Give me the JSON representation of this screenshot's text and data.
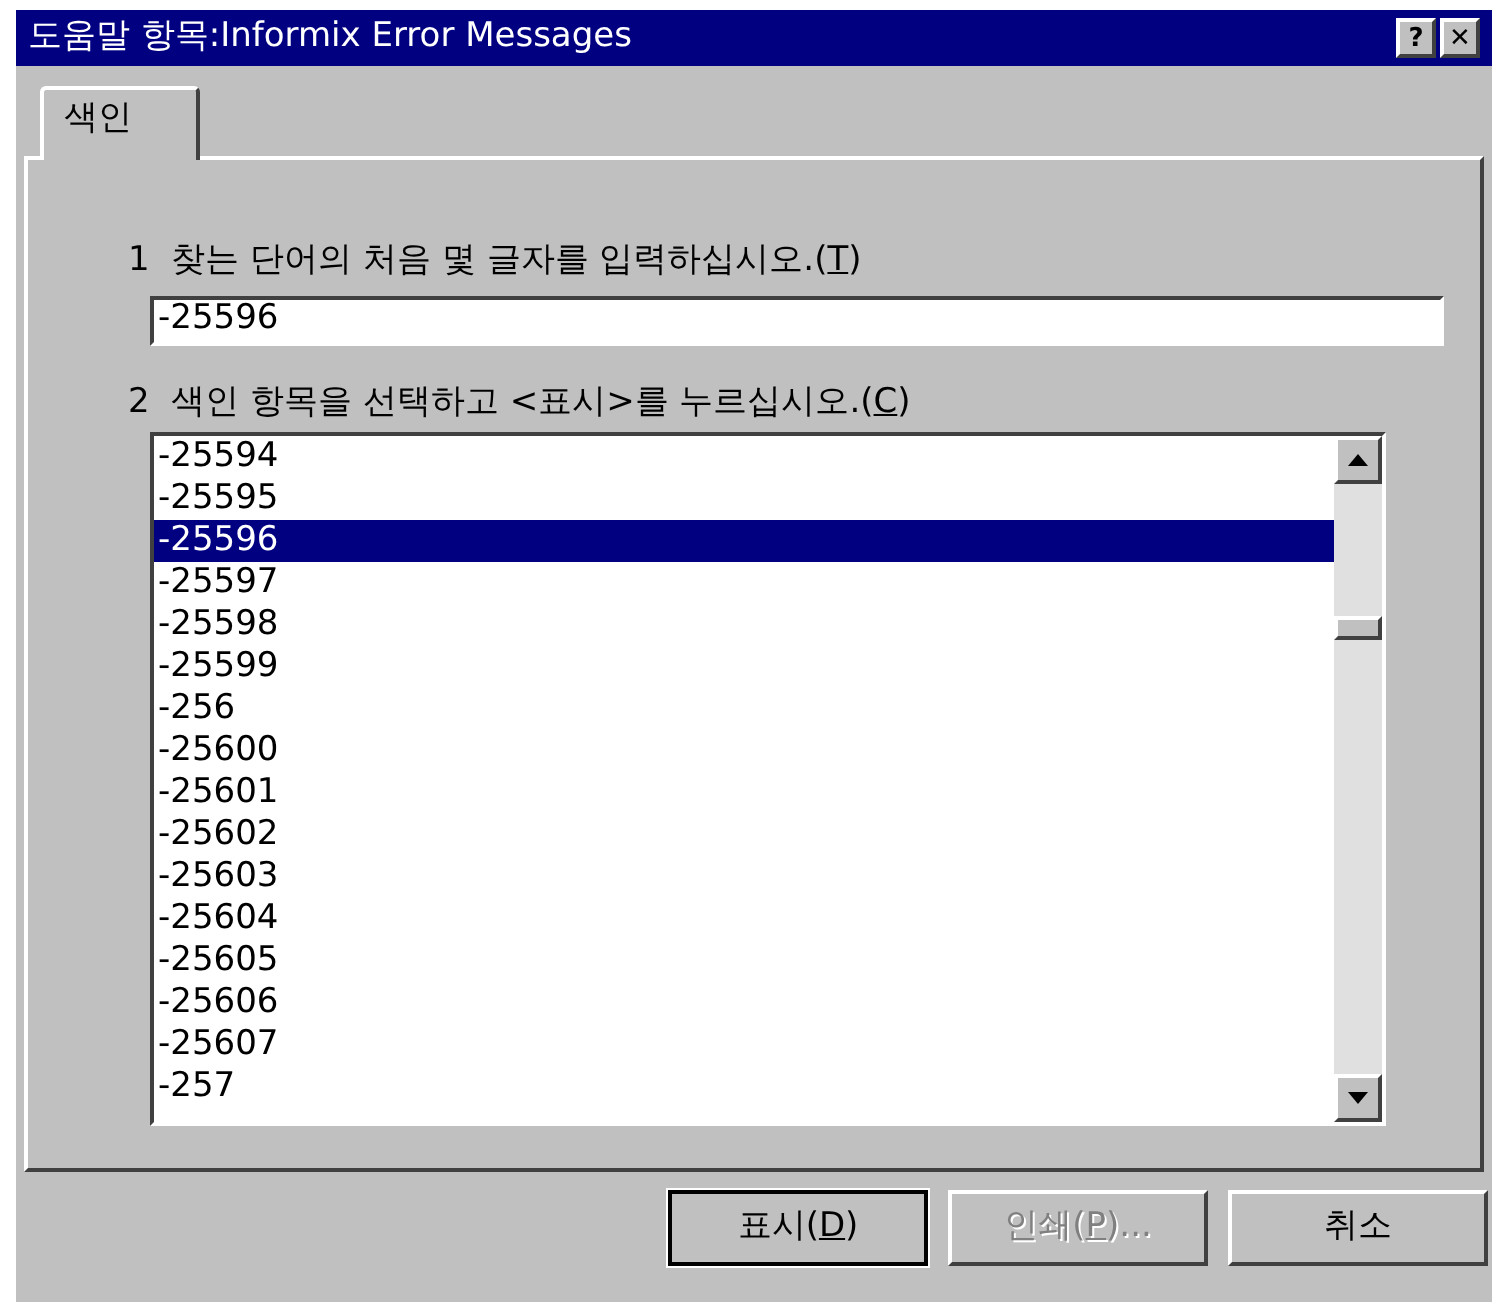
{
  "window": {
    "title": "도움말 항목:Informix Error Messages",
    "controls": [
      {
        "label": "?"
      },
      {
        "label": "✕"
      }
    ]
  },
  "tabs": [
    {
      "label": "색인",
      "selected": true
    }
  ],
  "step_1": {
    "number": "1",
    "prefix": "찾는 단어의 처음 몇 글자를 입력하십시오.(",
    "key": "T",
    "suffix": ")",
    "value": "-25596"
  },
  "step_2": {
    "number": "2",
    "prefix": "색인 항목을 선택하고 <표시>를 누르십시오.(",
    "key": "C",
    "suffix": ")"
  },
  "index_list": [
    {
      "label": "-25594",
      "selected": false
    },
    {
      "label": "-25595",
      "selected": false
    },
    {
      "label": "-25596",
      "selected": true
    },
    {
      "label": "-25597",
      "selected": false
    },
    {
      "label": "-25598",
      "selected": false
    },
    {
      "label": "-25599",
      "selected": false
    },
    {
      "label": "-256",
      "selected": false
    },
    {
      "label": "-25600",
      "selected": false
    },
    {
      "label": "-25601",
      "selected": false
    },
    {
      "label": "-25602",
      "selected": false
    },
    {
      "label": "-25603",
      "selected": false
    },
    {
      "label": "-25604",
      "selected": false
    },
    {
      "label": "-25605",
      "selected": false
    },
    {
      "label": "-25606",
      "selected": false
    },
    {
      "label": "-25607",
      "selected": false
    },
    {
      "label": "-257",
      "selected": false
    }
  ],
  "buttons": [
    {
      "prefix": "표시(",
      "key": "D",
      "suffix": ")",
      "disabled": false
    },
    {
      "prefix": "인쇄(",
      "key": "P",
      "suffix": ")...",
      "disabled": true
    },
    {
      "prefix": "취소",
      "disabled": false
    }
  ]
}
